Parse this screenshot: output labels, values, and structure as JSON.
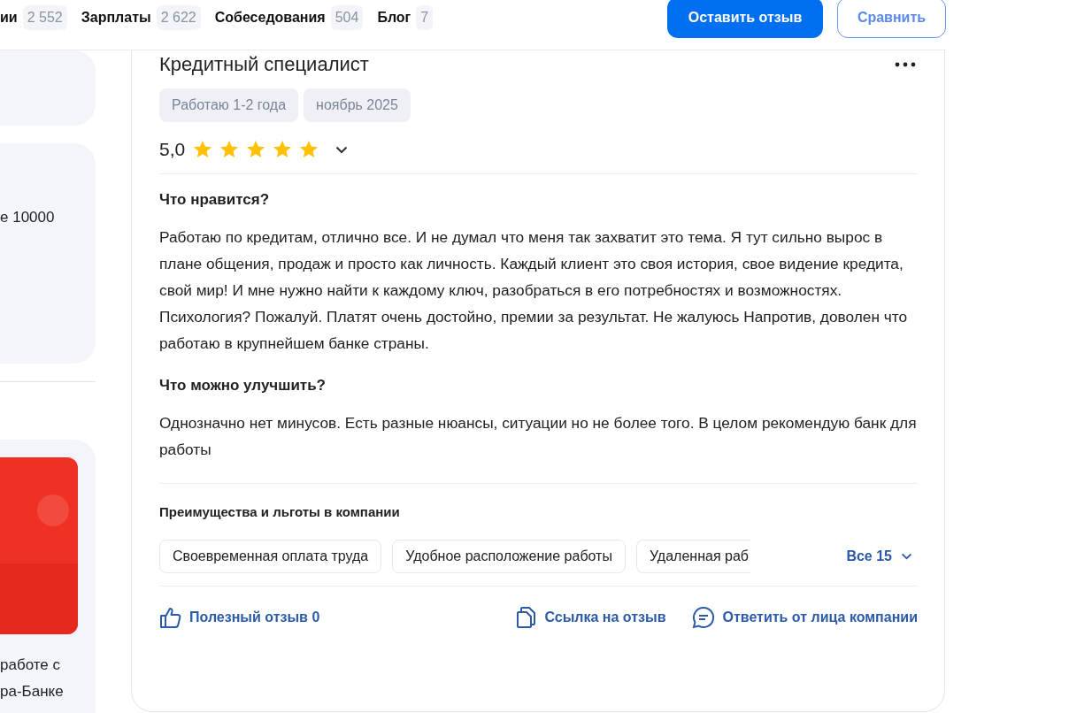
{
  "nav": {
    "tabs": [
      {
        "label": "ии",
        "count": "2 552"
      },
      {
        "label": "Зарплаты",
        "count": "2 622"
      },
      {
        "label": "Собеседования",
        "count": "504"
      },
      {
        "label": "Блог",
        "count": "7"
      }
    ],
    "buttons": [
      {
        "label": "Оставить отзыв",
        "kind": "primary"
      },
      {
        "label": "Сравнить",
        "kind": "outline"
      }
    ]
  },
  "sidebar": {
    "cards": [
      {
        "kind": "empty"
      },
      {
        "kind": "text",
        "text": "е 10000"
      },
      {
        "kind": "promo",
        "lines": [
          "работе с",
          "ра-Банке"
        ]
      }
    ]
  },
  "review": {
    "title": "Кредитный специалист",
    "tags": [
      "Работаю 1-2 года",
      "ноябрь 2025"
    ],
    "rating": "5,0",
    "stars": 5,
    "sections": [
      {
        "heading": "Что нравится?",
        "text": "Работаю по кредитам, отлично все. И не думал что меня так захватит это тема. Я тут сильно вырос в плане общения, продаж и просто как личность. Каждый клиент это своя история, свое видение кредита, свой мир! И мне нужно найти к каждому ключ, разобраться в его потребностях и возможностях. Психология? Пожалуй. Платят очень достойно, премии за результат. Не жалуюсь Напротив, доволен что работаю в крупнейшем банке страны."
      },
      {
        "heading": "Что можно улучшить?",
        "text": "Однозначно нет минусов. Есть разные нюансы, ситуации но не более того. В целом рекомендую банк для работы"
      }
    ],
    "benefits": {
      "title": "Преимущества и льготы в компании",
      "items": [
        "Своевременная оплата труда",
        "Удобное расположение работы",
        "Удаленная раб"
      ],
      "all": "Все 15"
    },
    "actions": [
      {
        "kind": "like",
        "label": "Полезный отзыв 0"
      },
      {
        "kind": "link",
        "label": "Ссылка на отзыв"
      },
      {
        "kind": "reply",
        "label": "Ответить от лица компании"
      }
    ]
  }
}
